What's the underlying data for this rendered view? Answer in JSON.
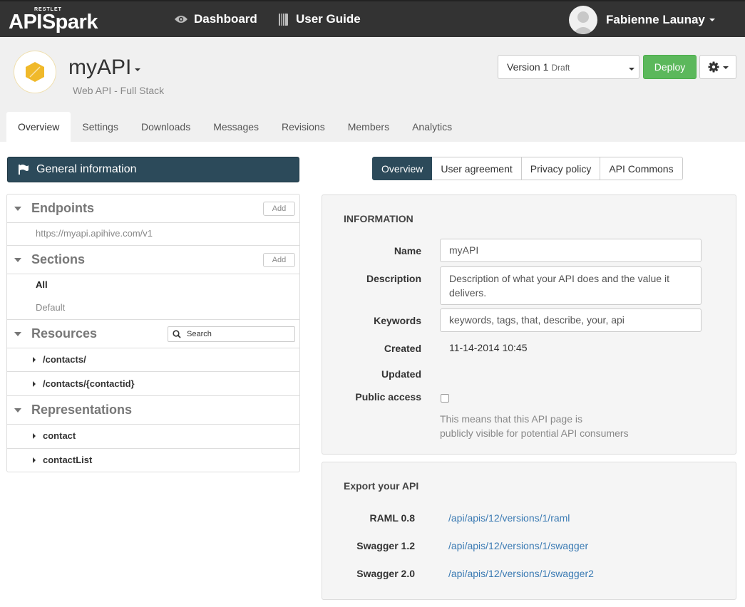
{
  "topbar": {
    "brand_small": "RESTLET",
    "brand_main": "APISpark",
    "dashboard": "Dashboard",
    "user_guide": "User Guide",
    "user_name": "Fabienne Launay"
  },
  "api": {
    "name": "myAPI",
    "subtitle": "Web API - Full Stack",
    "version_label": "Version 1",
    "version_status": "Draft",
    "deploy": "Deploy"
  },
  "tabs": [
    "Overview",
    "Settings",
    "Downloads",
    "Messages",
    "Revisions",
    "Members",
    "Analytics"
  ],
  "left": {
    "general_info": "General information",
    "endpoints": {
      "title": "Endpoints",
      "add": "Add",
      "items": [
        "https://myapi.apihive.com/v1"
      ]
    },
    "sections": {
      "title": "Sections",
      "add": "Add",
      "items": [
        "All",
        "Default"
      ]
    },
    "resources": {
      "title": "Resources",
      "search_placeholder": "Search",
      "items": [
        "/contacts/",
        "/contacts/{contactid}"
      ]
    },
    "representations": {
      "title": "Representations",
      "items": [
        "contact",
        "contactList"
      ]
    }
  },
  "pills": [
    "Overview",
    "User agreement",
    "Privacy policy",
    "API Commons"
  ],
  "information": {
    "title": "INFORMATION",
    "name_label": "Name",
    "name_value": "myAPI",
    "description_label": "Description",
    "description_value": "Description of what your API does and the value it delivers.",
    "keywords_label": "Keywords",
    "keywords_value": "keywords, tags, that, describe, your, api",
    "created_label": "Created",
    "created_value": "11-14-2014 10:45",
    "updated_label": "Updated",
    "updated_value": "",
    "public_label": "Public access",
    "public_checked": false,
    "help_line1": "This means that this API page is",
    "help_line2": "publicly visible for potential API consumers"
  },
  "export": {
    "title": "Export your API",
    "rows": [
      {
        "label": "RAML 0.8",
        "link": "/api/apis/12/versions/1/raml"
      },
      {
        "label": "Swagger 1.2",
        "link": "/api/apis/12/versions/1/swagger"
      },
      {
        "label": "Swagger 2.0",
        "link": "/api/apis/12/versions/1/swagger2"
      }
    ]
  },
  "colors": {
    "topbar": "#333333",
    "header_bg": "#f0f0f0",
    "primary_dark": "#2c4a5a",
    "deploy_green": "#5cb85c",
    "link_blue": "#3a7ab3",
    "api_logo": "#f0b92a"
  }
}
